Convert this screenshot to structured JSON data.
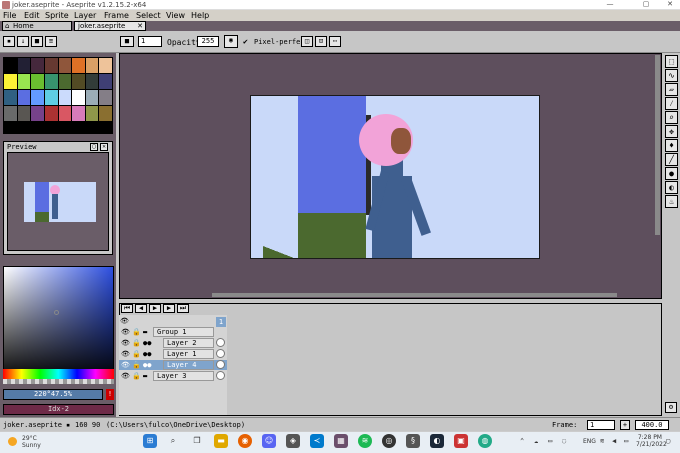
{
  "window": {
    "title": "joker.aseprite - Aseprite v1.2.15.2-x64"
  },
  "menu": [
    "File",
    "Edit",
    "Sprite",
    "Layer",
    "Frame",
    "Select",
    "View",
    "Help"
  ],
  "tabs": [
    {
      "label": "Home"
    },
    {
      "label": "joker.aseprite"
    }
  ],
  "toolbar": {
    "brush_size": "1",
    "opacity_label": "Opacity:",
    "opacity_value": "255",
    "pixel_perfect_label": "Pixel-perfect"
  },
  "palette": [
    "#000000",
    "#222034",
    "#45283c",
    "#663931",
    "#8f563b",
    "#df7126",
    "#d9a066",
    "#eec39a",
    "#fbf236",
    "#99e550",
    "#6abe30",
    "#37946e",
    "#4b692f",
    "#524b24",
    "#323c39",
    "#3f3f74",
    "#306082",
    "#5b6ee1",
    "#639bff",
    "#5fcde4",
    "#cbdbfc",
    "#ffffff",
    "#9badb7",
    "#847e87",
    "#696a6a",
    "#595652",
    "#76428a",
    "#ac3232",
    "#d95763",
    "#d77bba",
    "#8f974a",
    "#8a6f30"
  ],
  "preview": {
    "title": "Preview"
  },
  "color": {
    "fg_label": "220°47.5%",
    "bg_label": "Idx-2",
    "fg_color": "#557ba7",
    "bg_color": "#6e2a48"
  },
  "layers": [
    {
      "name": "Group 1",
      "selected": false
    },
    {
      "name": "Layer 2",
      "selected": false
    },
    {
      "name": "Layer 1",
      "selected": false
    },
    {
      "name": "Layer 4",
      "selected": true
    },
    {
      "name": "Layer 3",
      "selected": false
    }
  ],
  "timeline": {
    "frame_num": "1"
  },
  "status": {
    "file": "joker.aseprite",
    "size": "160 90",
    "path": "(C:\\Users\\fulco\\OneDrive\\Desktop)",
    "frame_label": "Frame:",
    "frame_value": "1",
    "zoom": "400.0"
  },
  "taskbar": {
    "temp": "29°C",
    "weather": "Sunny",
    "lang": "ENG",
    "time": "7:28 PM",
    "date": "7/21/2022"
  },
  "right_tools": [
    "marquee-icon",
    "lasso-icon",
    "eraser-icon",
    "eyedropper-icon",
    "zoom-icon",
    "move-icon",
    "fill-icon",
    "line-icon",
    "ellipse-icon",
    "contour-icon",
    "blur-icon"
  ]
}
